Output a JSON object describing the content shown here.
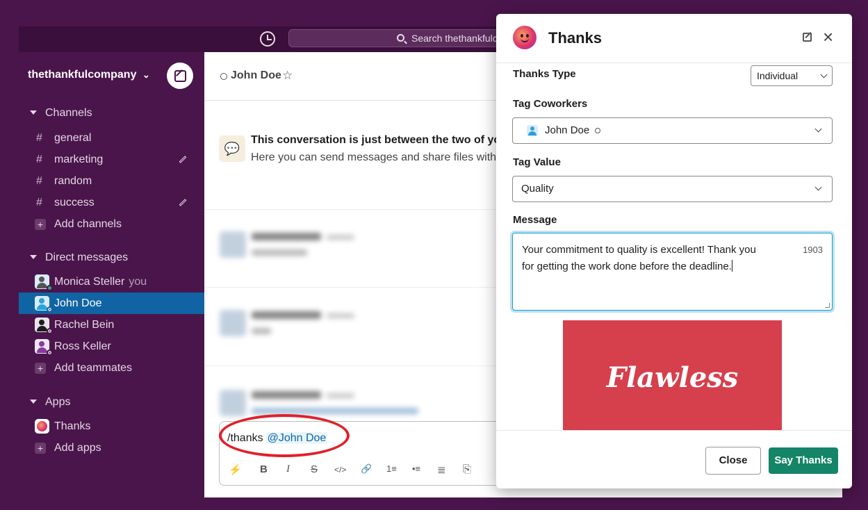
{
  "search": {
    "placeholder": "Search thethankfulc"
  },
  "workspace": {
    "name": "thethankfulcompany",
    "chevron": "⌄"
  },
  "sidebar": {
    "channels_header": "Channels",
    "channels": [
      {
        "hash": "#",
        "label": "general"
      },
      {
        "hash": "#",
        "label": "marketing"
      },
      {
        "hash": "#",
        "label": "random"
      },
      {
        "hash": "#",
        "label": "success"
      }
    ],
    "add_channels": "Add channels",
    "dm_header": "Direct messages",
    "dms": [
      {
        "label": "Monica Steller",
        "suffix": "you"
      },
      {
        "label": "John Doe"
      },
      {
        "label": "Rachel Bein"
      },
      {
        "label": "Ross Keller"
      }
    ],
    "add_teammates": "Add teammates",
    "apps_header": "Apps",
    "apps": [
      {
        "label": "Thanks"
      }
    ],
    "add_apps": "Add apps",
    "plus": "+"
  },
  "channel": {
    "name": "John Doe",
    "star": "☆",
    "intro_icon": "💬",
    "intro_title": "This conversation is just between the two of you",
    "intro_sub": "Here you can send messages and share files with ",
    "intro_mention": "@"
  },
  "composer": {
    "command": "/thanks",
    "mention": "@John Doe",
    "tools": {
      "bolt": "⚡",
      "bold": "B",
      "italic": "I",
      "strike": "S",
      "code": "</>",
      "link": "🔗",
      "ordered": "1≡",
      "bullets": "•≡",
      "block": "≣",
      "snippet": "⎘"
    }
  },
  "modal": {
    "title": "Thanks",
    "close_glyph": "×",
    "thanks_type_label": "Thanks Type",
    "thanks_type_value": "Individual",
    "tag_coworkers_label": "Tag Coworkers",
    "tag_coworkers_value": "John Doe",
    "tag_value_label": "Tag Value",
    "tag_value_value": "Quality",
    "message_label": "Message",
    "message_text": "Your commitment to quality is excellent! Thank you for getting the work done before the deadline.",
    "char_count": "1903",
    "gif_text": "Flawless",
    "close_button": "Close",
    "say_thanks_button": "Say Thanks"
  },
  "colors": {
    "sidebar": "#4a154b",
    "selected": "#1164a3",
    "primary_button": "#148567",
    "highlight_ring": "#e0202a"
  }
}
